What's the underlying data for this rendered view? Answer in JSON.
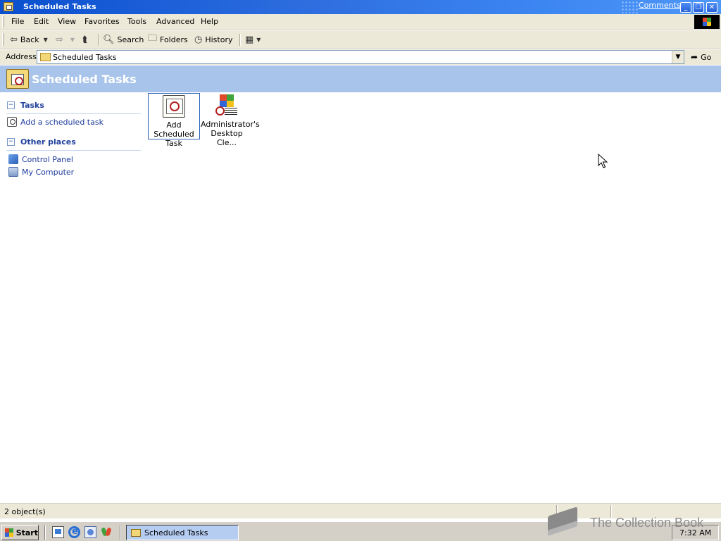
{
  "window": {
    "title": "Scheduled Tasks",
    "comments_link": "Comments?",
    "buttons": {
      "minimize": "_",
      "maximize": "❐",
      "close": "✕"
    }
  },
  "menu": [
    "File",
    "Edit",
    "View",
    "Favorites",
    "Tools",
    "Advanced",
    "Help"
  ],
  "toolbar": {
    "back": "Back",
    "search": "Search",
    "folders": "Folders",
    "history": "History"
  },
  "address": {
    "label": "Address",
    "value": "Scheduled Tasks",
    "go": "Go"
  },
  "header": {
    "title": "Scheduled Tasks"
  },
  "taskpane": {
    "tasks_title": "Tasks",
    "tasks": [
      "Add a scheduled task"
    ],
    "other_title": "Other places",
    "other": [
      "Control Panel",
      "My Computer"
    ]
  },
  "items": [
    {
      "label": "Add Scheduled Task",
      "icon": "add-scheduled-task-icon",
      "selected": true
    },
    {
      "label": "Administrator's Desktop Cle...",
      "icon": "desktop-cleanup-task-icon",
      "selected": false
    }
  ],
  "status": {
    "text": "2 object(s)"
  },
  "taskbar": {
    "start": "Start",
    "task_button": "Scheduled Tasks",
    "clock": "7:32 AM"
  },
  "watermark": {
    "text": "The Collection Book"
  },
  "colors": {
    "titlebar": "#2f6fe0",
    "header_band": "#a8c4eb",
    "link": "#1d3b9c",
    "pane_title": "#21419b",
    "chrome": "#ece9d8",
    "taskbar": "#d4d0c8"
  }
}
